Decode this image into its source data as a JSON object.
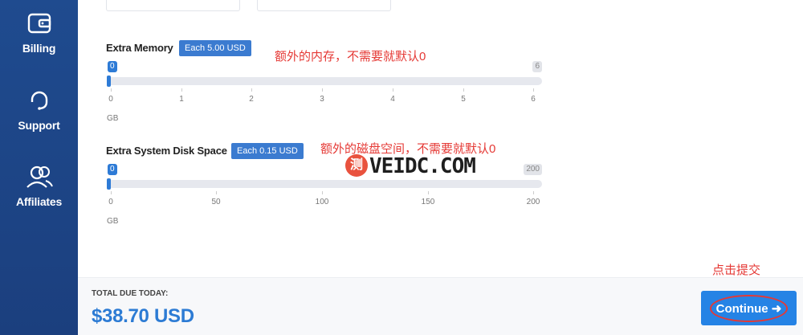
{
  "sidebar": {
    "items": [
      {
        "label": "Billing",
        "icon": "wallet-icon"
      },
      {
        "label": "Support",
        "icon": "headset-icon"
      },
      {
        "label": "Affiliates",
        "icon": "people-icon"
      }
    ]
  },
  "options": [
    {
      "title": "Extra Memory",
      "badge": "Each 5.00 USD",
      "annotation": "额外的内存，不需要就默认0",
      "min_label": "0",
      "max_label": "6",
      "ticks": [
        "0",
        "1",
        "2",
        "3",
        "4",
        "5",
        "6"
      ],
      "unit": "GB",
      "value": 0
    },
    {
      "title": "Extra System Disk Space",
      "badge": "Each 0.15 USD",
      "annotation": "额外的磁盘空间，不需要就默认0",
      "min_label": "0",
      "max_label": "200",
      "ticks": [
        "0",
        "50",
        "100",
        "150",
        "200"
      ],
      "unit": "GB",
      "value": 0
    }
  ],
  "watermark": {
    "mark": "测",
    "text": "VEIDC.COM"
  },
  "footer": {
    "due_label": "TOTAL DUE TODAY:",
    "due_value": "$38.70 USD",
    "submit_annotation": "点击提交",
    "continue_label": "Continue",
    "continue_icon": "arrow-right-icon"
  },
  "colors": {
    "sidebar": "#1f4b8f",
    "accent": "#2583e5",
    "annotation": "#e53935",
    "price": "#2c7bd4"
  }
}
